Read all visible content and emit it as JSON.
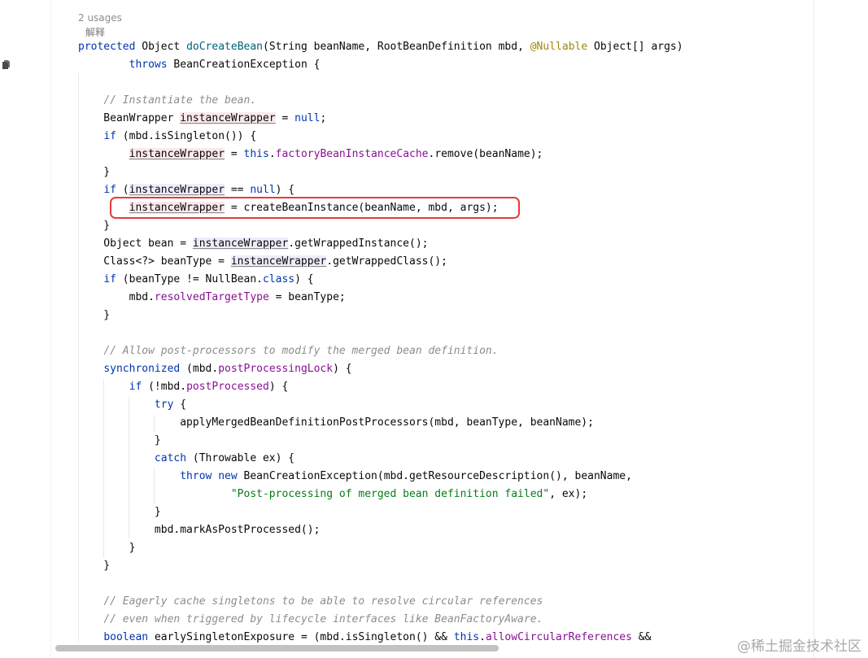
{
  "editor": {
    "usages_hint": "2 usages",
    "explain_action": "解释",
    "watermark": "@稀土掘金技术社区",
    "lines": [
      [
        {
          "c": "kw",
          "t": "protected"
        },
        {
          "t": " Object "
        },
        {
          "c": "mth",
          "t": "doCreateBean"
        },
        {
          "t": "(String beanName, RootBeanDefinition mbd, "
        },
        {
          "c": "ann",
          "t": "@Nullable"
        },
        {
          "t": " Object[] args)"
        }
      ],
      [
        {
          "t": "        "
        },
        {
          "c": "kw",
          "t": "throws"
        },
        {
          "t": " BeanCreationException {"
        }
      ],
      [],
      [
        {
          "t": "    "
        },
        {
          "c": "cmt",
          "t": "// Instantiate the bean."
        }
      ],
      [
        {
          "t": "    BeanWrapper "
        },
        {
          "c": "lv lvw",
          "t": "instanceWrapper"
        },
        {
          "t": " = "
        },
        {
          "c": "kw",
          "t": "null"
        },
        {
          "t": ";"
        }
      ],
      [
        {
          "t": "    "
        },
        {
          "c": "kw",
          "t": "if"
        },
        {
          "t": " (mbd.isSingleton()) {"
        }
      ],
      [
        {
          "t": "        "
        },
        {
          "c": "lv lvw",
          "t": "instanceWrapper"
        },
        {
          "t": " = "
        },
        {
          "c": "kw",
          "t": "this"
        },
        {
          "t": "."
        },
        {
          "c": "fld",
          "t": "factoryBeanInstanceCache"
        },
        {
          "t": ".remove(beanName);"
        }
      ],
      [
        {
          "t": "    }"
        }
      ],
      [
        {
          "t": "    "
        },
        {
          "c": "kw",
          "t": "if"
        },
        {
          "t": " ("
        },
        {
          "c": "lv lvr",
          "t": "instanceWrapper"
        },
        {
          "t": " == "
        },
        {
          "c": "kw",
          "t": "null"
        },
        {
          "t": ") {"
        }
      ],
      [
        {
          "t": "        "
        },
        {
          "c": "lv lvw",
          "t": "instanceWrapper"
        },
        {
          "t": " = createBeanInstance(beanName, mbd, args);"
        }
      ],
      [
        {
          "t": "    }"
        }
      ],
      [
        {
          "t": "    Object bean = "
        },
        {
          "c": "lv lvr",
          "t": "instanceWrapper"
        },
        {
          "t": ".getWrappedInstance();"
        }
      ],
      [
        {
          "t": "    Class<?> beanType = "
        },
        {
          "c": "lv lvr",
          "t": "instanceWrapper"
        },
        {
          "t": ".getWrappedClass();"
        }
      ],
      [
        {
          "t": "    "
        },
        {
          "c": "kw",
          "t": "if"
        },
        {
          "t": " (beanType != NullBean."
        },
        {
          "c": "kw",
          "t": "class"
        },
        {
          "t": ") {"
        }
      ],
      [
        {
          "t": "        mbd."
        },
        {
          "c": "fld",
          "t": "resolvedTargetType"
        },
        {
          "t": " = beanType;"
        }
      ],
      [
        {
          "t": "    }"
        }
      ],
      [],
      [
        {
          "t": "    "
        },
        {
          "c": "cmt",
          "t": "// Allow post-processors to modify the merged bean definition."
        }
      ],
      [
        {
          "t": "    "
        },
        {
          "c": "kw",
          "t": "synchronized"
        },
        {
          "t": " (mbd."
        },
        {
          "c": "fld",
          "t": "postProcessingLock"
        },
        {
          "t": ") {"
        }
      ],
      [
        {
          "t": "        "
        },
        {
          "c": "kw",
          "t": "if"
        },
        {
          "t": " (!mbd."
        },
        {
          "c": "fld",
          "t": "postProcessed"
        },
        {
          "t": ") {"
        }
      ],
      [
        {
          "t": "            "
        },
        {
          "c": "kw",
          "t": "try"
        },
        {
          "t": " {"
        }
      ],
      [
        {
          "t": "                applyMergedBeanDefinitionPostProcessors(mbd, beanType, beanName);"
        }
      ],
      [
        {
          "t": "            }"
        }
      ],
      [
        {
          "t": "            "
        },
        {
          "c": "kw",
          "t": "catch"
        },
        {
          "t": " (Throwable ex) {"
        }
      ],
      [
        {
          "t": "                "
        },
        {
          "c": "kw",
          "t": "throw new"
        },
        {
          "t": " BeanCreationException(mbd.getResourceDescription(), beanName,"
        }
      ],
      [
        {
          "t": "                        "
        },
        {
          "c": "str",
          "t": "\"Post-processing of merged bean definition failed\""
        },
        {
          "t": ", ex);"
        }
      ],
      [
        {
          "t": "            }"
        }
      ],
      [
        {
          "t": "            mbd.markAsPostProcessed();"
        }
      ],
      [
        {
          "t": "        }"
        }
      ],
      [
        {
          "t": "    }"
        }
      ],
      [],
      [
        {
          "t": "    "
        },
        {
          "c": "cmt",
          "t": "// Eagerly cache singletons to be able to resolve circular references"
        }
      ],
      [
        {
          "t": "    "
        },
        {
          "c": "cmt",
          "t": "// even when triggered by lifecycle interfaces like BeanFactoryAware."
        }
      ],
      [
        {
          "t": "    "
        },
        {
          "c": "kw",
          "t": "boolean"
        },
        {
          "t": " earlySingletonExposure = (mbd.isSingleton() && "
        },
        {
          "c": "kw",
          "t": "this"
        },
        {
          "t": "."
        },
        {
          "c": "fld",
          "t": "allowCircularReferences"
        },
        {
          "t": " &&"
        }
      ]
    ]
  }
}
